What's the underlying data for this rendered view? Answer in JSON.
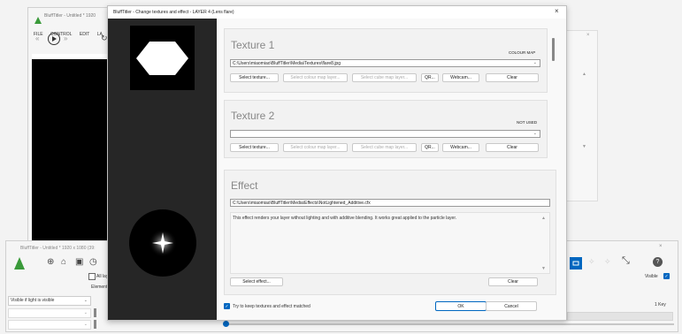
{
  "background_window": {
    "title": "BluffTitler - Untitled * 1920",
    "menu": [
      "FILE",
      "CONTROL",
      "EDIT",
      "LA"
    ]
  },
  "bottom_window": {
    "title": "BluffTitler - Untitled * 1920 x 1080 (39:",
    "all_layers_label": "All laye",
    "elements_label": "Elements",
    "visible_if_light_label": "Visible if light is visible",
    "visible_label": "Visible",
    "key_label": "1 Key"
  },
  "dialog": {
    "title": "BluffTitler - Change textures and effect - LAYER 4 (Lens flare)",
    "close": "×",
    "texture1": {
      "heading": "Texture 1",
      "usage": "COLOUR MAP",
      "path": "C:\\Users\\miaomiao\\BluffTitler\\Media\\Textures\\flare8.jpg",
      "buttons": [
        "Select texture...",
        "Select colour map layer...",
        "Select cube map layer...",
        "QR...",
        "Webcam...",
        "Clear"
      ]
    },
    "texture2": {
      "heading": "Texture 2",
      "usage": "NOT USED",
      "path": "",
      "buttons": [
        "Select texture...",
        "Select colour map layer...",
        "Select cube map layer...",
        "QR...",
        "Webcam...",
        "Clear"
      ]
    },
    "effect": {
      "heading": "Effect",
      "path": "C:\\Users\\miaomiao\\BluffTitler\\Media\\Effects\\NotLightened_Additive.cfx",
      "description": "This effect renders your layer without lighting and with additive blending. It works great applied to the particle layer.",
      "select_button": "Select effect...",
      "clear_button": "Clear"
    },
    "keep_matched_label": "Try to keep textures and effect matched",
    "ok": "OK",
    "cancel": "Cancel"
  },
  "colors": {
    "dialog_left_bg": "#262626",
    "accent": "#0067c0"
  }
}
